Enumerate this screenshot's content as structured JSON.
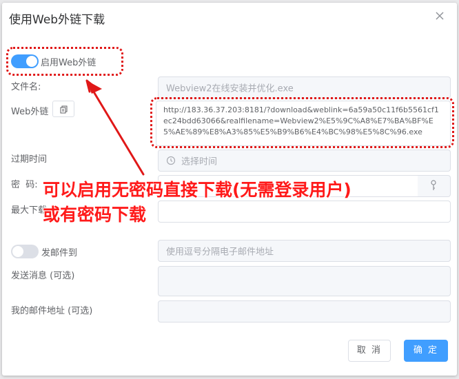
{
  "dialog": {
    "title": "使用Web外链下载",
    "close_icon": "close-icon"
  },
  "enable_weblink": {
    "label": "启用Web外链",
    "enabled": true
  },
  "file_name": {
    "label": "文件名:",
    "value": "Webview2在线安装并优化.exe"
  },
  "weblink": {
    "label": "Web外链",
    "copy_icon": "copy-icon",
    "url": "http://183.36.37.203:8181/?download&weblink=6a59a50c11f6b5561cf1ec24bdd63066&realfilename=Webview2%E5%9C%A8%E7%BA%BF%E5%AE%89%E8%A3%85%E5%B9%B6%E4%BC%98%E5%8C%96.exe"
  },
  "expire": {
    "label": "过期时间",
    "placeholder": "选择时间",
    "icon": "clock-icon"
  },
  "password": {
    "label": "密  码:",
    "value": "",
    "icon": "key-icon"
  },
  "max_downloads": {
    "label": "最大下载",
    "value": ""
  },
  "email": {
    "toggle_label": "发邮件到",
    "enabled": false,
    "placeholder": "使用逗号分隔电子邮件地址"
  },
  "message": {
    "label": "发送消息 (可选)",
    "value": ""
  },
  "my_email": {
    "label": "我的邮件地址 (可选)",
    "value": ""
  },
  "buttons": {
    "cancel": "取 消",
    "ok": "确 定"
  },
  "annotation": {
    "line1": "可以启用无密码直接下载(无需登录用户)",
    "line2": "或有密码下载",
    "color": "#ff1a1a"
  },
  "colors": {
    "primary": "#409eff",
    "annotation": "#e01818"
  }
}
